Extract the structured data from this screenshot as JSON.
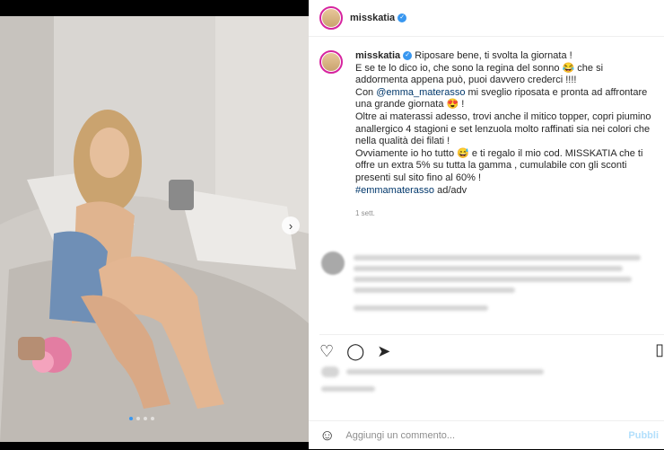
{
  "post": {
    "username": "misskatia",
    "verified_icon": "verified-badge-icon"
  },
  "caption": {
    "username": "misskatia",
    "line1": "Riposare bene, ti svolta la giornata !",
    "line2": "E se te lo dico io, che sono la regina del sonno 😂 che si addormenta appena può, puoi davvero crederci !!!!",
    "line3_pre": "Con ",
    "mention": "@emma_materasso",
    "line3_post": " mi sveglio riposata e pronta ad affrontare una grande giornata 😍 !",
    "line4": "Oltre ai materassi adesso, trovi anche il mitico topper, copri piumino anallergico 4 stagioni e set lenzuola molto raffinati sia nei colori che nella qualità dei filati !",
    "line5": "Ovviamente io ho tutto 😅 e ti regalo il mio cod. MISSKATIA che ti offre un extra 5% su tutta la gamma , cumulabile con gli sconti presenti sul sito fino al 60% !",
    "hashtag": "#emmamaterasso",
    "hashtag_post": " ad/adv",
    "time": "1 sett."
  },
  "actions": {
    "like_icon": "heart-icon",
    "comment_icon": "comment-icon",
    "share_icon": "share-icon",
    "save_icon": "bookmark-icon"
  },
  "comment_bar": {
    "emoji_icon": "emoji-icon",
    "placeholder": "Aggiungi un commento...",
    "publish_label": "Pubbli"
  },
  "carousel": {
    "slides": 4,
    "active": 1,
    "next_icon": "chevron-right-icon"
  }
}
